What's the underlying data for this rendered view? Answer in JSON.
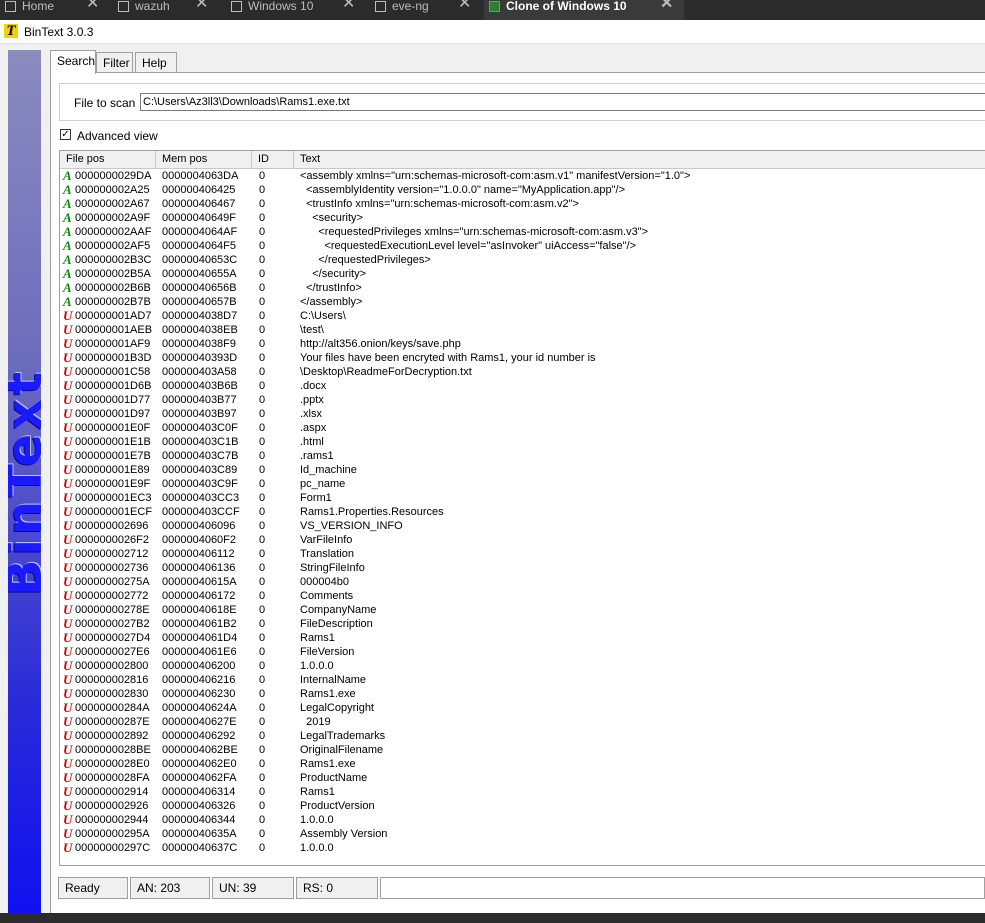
{
  "host_tabs": [
    {
      "label": "Home",
      "active": false
    },
    {
      "label": "wazuh",
      "active": false
    },
    {
      "label": "Windows 10",
      "active": false
    },
    {
      "label": "eve-ng",
      "active": false
    },
    {
      "label": "Clone of Windows 10",
      "active": true
    }
  ],
  "window": {
    "title": "BinText 3.0.3",
    "brand": "BinText"
  },
  "tabs": [
    "Search",
    "Filter",
    "Help"
  ],
  "scan": {
    "label": "File to scan",
    "value": "C:\\Users\\Az3ll3\\Downloads\\Rams1.exe.txt"
  },
  "advanced_view": {
    "label": "Advanced view",
    "checked": true
  },
  "columns": [
    "File pos",
    "Mem pos",
    "ID",
    "Text"
  ],
  "rows": [
    [
      "A",
      "0000000029DA",
      "0000004063DA",
      "0",
      "<assembly xmlns=\"urn:schemas-microsoft-com:asm.v1\" manifestVersion=\"1.0\">"
    ],
    [
      "A",
      "000000002A25",
      "000000406425",
      "0",
      "  <assemblyIdentity version=\"1.0.0.0\" name=\"MyApplication.app\"/>"
    ],
    [
      "A",
      "000000002A67",
      "000000406467",
      "0",
      "  <trustInfo xmlns=\"urn:schemas-microsoft-com:asm.v2\">"
    ],
    [
      "A",
      "000000002A9F",
      "00000040649F",
      "0",
      "    <security>"
    ],
    [
      "A",
      "000000002AAF",
      "0000004064AF",
      "0",
      "      <requestedPrivileges xmlns=\"urn:schemas-microsoft-com:asm.v3\">"
    ],
    [
      "A",
      "000000002AF5",
      "0000004064F5",
      "0",
      "        <requestedExecutionLevel level=\"asInvoker\" uiAccess=\"false\"/>"
    ],
    [
      "A",
      "000000002B3C",
      "00000040653C",
      "0",
      "      </requestedPrivileges>"
    ],
    [
      "A",
      "000000002B5A",
      "00000040655A",
      "0",
      "    </security>"
    ],
    [
      "A",
      "000000002B6B",
      "00000040656B",
      "0",
      "  </trustInfo>"
    ],
    [
      "A",
      "000000002B7B",
      "00000040657B",
      "0",
      "</assembly>"
    ],
    [
      "U",
      "000000001AD7",
      "0000004038D7",
      "0",
      "C:\\Users\\"
    ],
    [
      "U",
      "000000001AEB",
      "0000004038EB",
      "0",
      "\\test\\"
    ],
    [
      "U",
      "000000001AF9",
      "0000004038F9",
      "0",
      "http://alt356.onion/keys/save.php"
    ],
    [
      "U",
      "000000001B3D",
      "00000040393D",
      "0",
      "Your files have been encryted with Rams1, your id number is"
    ],
    [
      "U",
      "000000001C58",
      "000000403A58",
      "0",
      "\\Desktop\\ReadmeForDecryption.txt"
    ],
    [
      "U",
      "000000001D6B",
      "000000403B6B",
      "0",
      ".docx"
    ],
    [
      "U",
      "000000001D77",
      "000000403B77",
      "0",
      ".pptx"
    ],
    [
      "U",
      "000000001D97",
      "000000403B97",
      "0",
      ".xlsx"
    ],
    [
      "U",
      "000000001E0F",
      "000000403C0F",
      "0",
      ".aspx"
    ],
    [
      "U",
      "000000001E1B",
      "000000403C1B",
      "0",
      ".html"
    ],
    [
      "U",
      "000000001E7B",
      "000000403C7B",
      "0",
      ".rams1"
    ],
    [
      "U",
      "000000001E89",
      "000000403C89",
      "0",
      "Id_machine"
    ],
    [
      "U",
      "000000001E9F",
      "000000403C9F",
      "0",
      "pc_name"
    ],
    [
      "U",
      "000000001EC3",
      "000000403CC3",
      "0",
      "Form1"
    ],
    [
      "U",
      "000000001ECF",
      "000000403CCF",
      "0",
      "Rams1.Properties.Resources"
    ],
    [
      "U",
      "000000002696",
      "000000406096",
      "0",
      "VS_VERSION_INFO"
    ],
    [
      "U",
      "0000000026F2",
      "0000004060F2",
      "0",
      "VarFileInfo"
    ],
    [
      "U",
      "000000002712",
      "000000406112",
      "0",
      "Translation"
    ],
    [
      "U",
      "000000002736",
      "000000406136",
      "0",
      "StringFileInfo"
    ],
    [
      "U",
      "00000000275A",
      "00000040615A",
      "0",
      "000004b0"
    ],
    [
      "U",
      "000000002772",
      "000000406172",
      "0",
      "Comments"
    ],
    [
      "U",
      "00000000278E",
      "00000040618E",
      "0",
      "CompanyName"
    ],
    [
      "U",
      "0000000027B2",
      "0000004061B2",
      "0",
      "FileDescription"
    ],
    [
      "U",
      "0000000027D4",
      "0000004061D4",
      "0",
      "Rams1"
    ],
    [
      "U",
      "0000000027E6",
      "0000004061E6",
      "0",
      "FileVersion"
    ],
    [
      "U",
      "000000002800",
      "000000406200",
      "0",
      "1.0.0.0"
    ],
    [
      "U",
      "000000002816",
      "000000406216",
      "0",
      "InternalName"
    ],
    [
      "U",
      "000000002830",
      "000000406230",
      "0",
      "Rams1.exe"
    ],
    [
      "U",
      "00000000284A",
      "00000040624A",
      "0",
      "LegalCopyright"
    ],
    [
      "U",
      "00000000287E",
      "00000040627E",
      "0",
      "  2019"
    ],
    [
      "U",
      "000000002892",
      "000000406292",
      "0",
      "LegalTrademarks"
    ],
    [
      "U",
      "0000000028BE",
      "0000004062BE",
      "0",
      "OriginalFilename"
    ],
    [
      "U",
      "0000000028E0",
      "0000004062E0",
      "0",
      "Rams1.exe"
    ],
    [
      "U",
      "0000000028FA",
      "0000004062FA",
      "0",
      "ProductName"
    ],
    [
      "U",
      "000000002914",
      "000000406314",
      "0",
      "Rams1"
    ],
    [
      "U",
      "000000002926",
      "000000406326",
      "0",
      "ProductVersion"
    ],
    [
      "U",
      "000000002944",
      "000000406344",
      "0",
      "1.0.0.0"
    ],
    [
      "U",
      "00000000295A",
      "00000040635A",
      "0",
      "Assembly Version"
    ],
    [
      "U",
      "00000000297C",
      "00000040637C",
      "0",
      "1.0.0.0"
    ]
  ],
  "status": {
    "state": "Ready",
    "an": "AN: 203",
    "un": "UN: 39",
    "rs": "RS: 0"
  },
  "colors": {
    "ansi_icon": "#0f8a0f",
    "unicode_icon": "#d00000",
    "brand_blue": "#1a1aff"
  }
}
